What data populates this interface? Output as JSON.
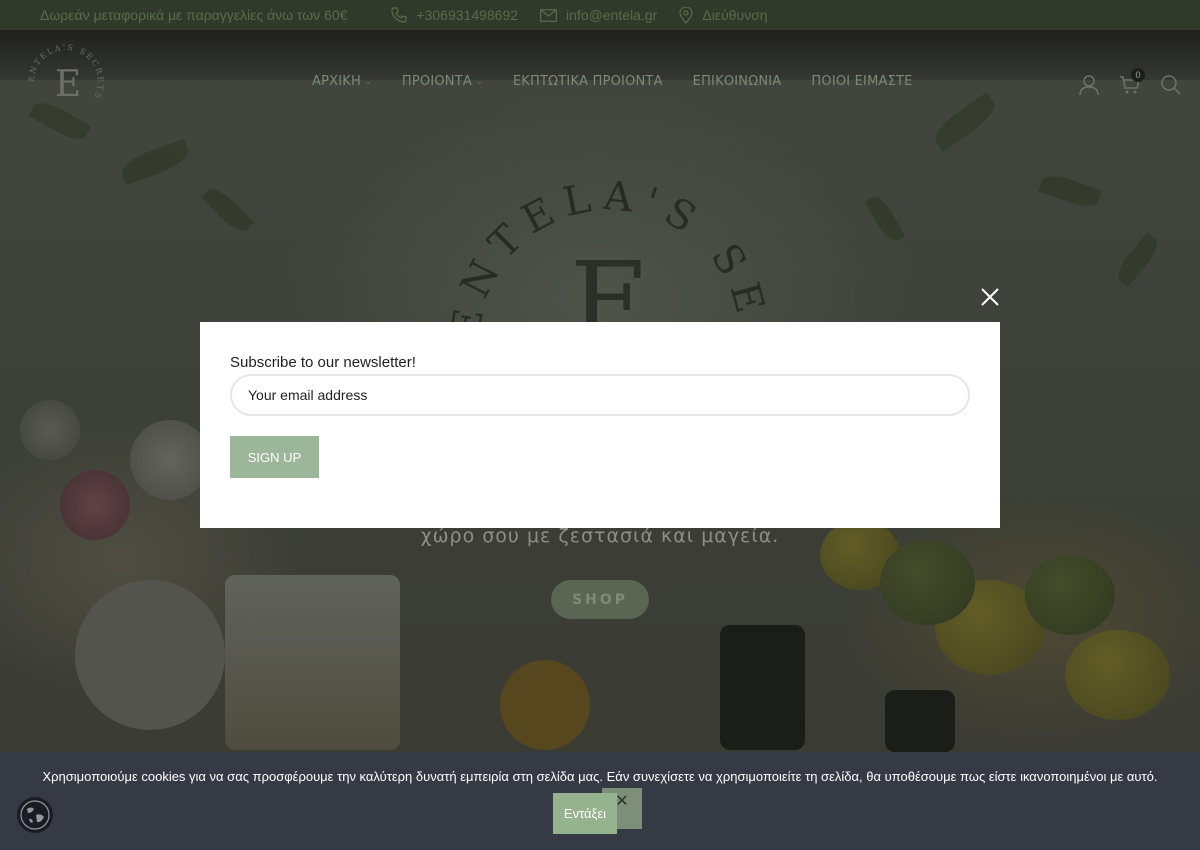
{
  "topbar": {
    "promo": "Δωρεάν μεταφορικά με παραγγελίες άνω των 60€",
    "phone": "+306931498692",
    "email": "info@entela.gr",
    "address": "Διεύθυνση"
  },
  "brand": {
    "name": "ENTELA'S SECRETS",
    "monogram": "E"
  },
  "nav": {
    "items": [
      {
        "label": "ΑΡΧΙΚΗ"
      },
      {
        "label": "ΠΡΟΙΟΝΤΑ"
      },
      {
        "label": "ΕΚΠΤΩΤΙΚΑ ΠΡΟΙΟΝΤΑ"
      },
      {
        "label": "ΕΠΙΚΟΙΝΩΝΙΑ"
      },
      {
        "label": "ΠΟΙΟΙ ΕΙΜΑΣΤΕ"
      }
    ],
    "cart_count": "0"
  },
  "hero": {
    "subtitle": "χώρο σου με ζεστασιά και μαγεία.",
    "cta": "SHOP"
  },
  "newsletter": {
    "label": "Subscribe to our newsletter!",
    "email_placeholder": "Your email address",
    "submit": "SIGN UP"
  },
  "cookie": {
    "text": "Χρησιμοποιούμε cookies για να σας προσφέρουμε την καλύτερη δυνατή εμπειρία στη σελίδα μας. Εάν συνεχίσετε να χρησιμοποιείτε τη σελίδα, θα υποθέσουμε πως είστε ικανοποιημένοι με αυτό.",
    "accept": "Εντάξει",
    "decline": "✕"
  },
  "colors": {
    "accent": "#9cb699",
    "topbar": "#2f3a2a",
    "cookie_bg": "#363a44"
  }
}
